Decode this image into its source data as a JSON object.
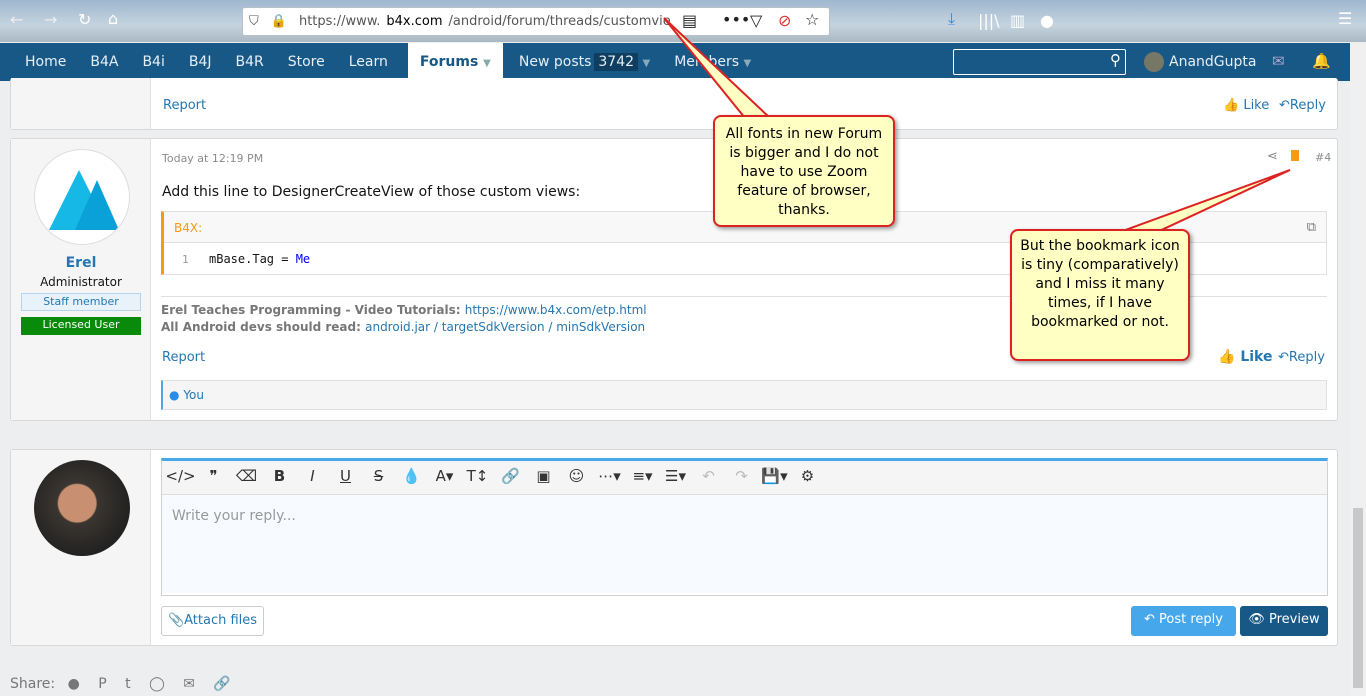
{
  "browser": {
    "url_prefix": "https://www.",
    "url_domain": "b4x.com",
    "url_rest": "/android/forum/threads/customvie"
  },
  "nav": {
    "items": [
      "Home",
      "B4A",
      "B4i",
      "B4J",
      "B4R",
      "Store",
      "Learn"
    ],
    "forums": "Forums",
    "new_posts": "New posts",
    "new_posts_count": "3742",
    "members": "Members",
    "user": "AnandGupta"
  },
  "prev_post": {
    "report": "Report",
    "like": "Like",
    "reply": "Reply"
  },
  "post": {
    "time": "Today at 12:19 PM",
    "number": "#4",
    "author": "Erel",
    "role": "Administrator",
    "badge1": "Staff member",
    "badge2": "Licensed User",
    "body": "Add this line to DesignerCreateView of those custom views:",
    "code_label": "B4X:",
    "line_no": "1",
    "code_a": "mBase.Tag = ",
    "code_b": "Me",
    "sig1_label": "Erel Teaches Programming - Video Tutorials: ",
    "sig1_link": "https://www.b4x.com/etp.html",
    "sig2_label": "All Android devs should read: ",
    "sig2_link": "android.jar / targetSdkVersion / minSdkVersion",
    "report": "Report",
    "like": "Like",
    "reply": "Reply",
    "reactions": "You"
  },
  "reply": {
    "placeholder": "Write your reply...",
    "attach": "Attach files",
    "post": "Post reply",
    "preview": "Preview"
  },
  "share": {
    "label": "Share:"
  },
  "callouts": {
    "one": "All fonts in new Forum is bigger and I do not have to use Zoom feature of browser, thanks.",
    "two": "But the bookmark icon is tiny (comparatively) and I miss it many times, if I have bookmarked or not."
  },
  "colors": {
    "nav": "#185886",
    "accent": "#2577b1",
    "licensed": "#0a8a0a"
  }
}
